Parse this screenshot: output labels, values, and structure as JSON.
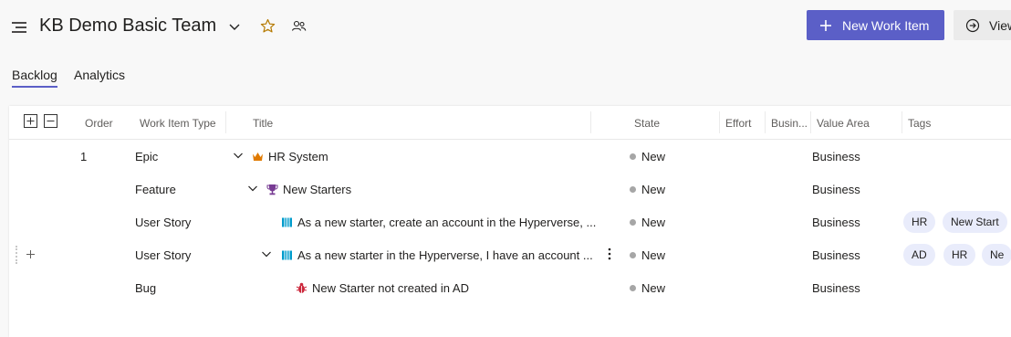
{
  "header": {
    "team_title": "KB Demo Basic Team",
    "new_work_item_label": "New Work Item",
    "view_label": "View",
    "accent_color": "#5b5fc7"
  },
  "tabs": [
    {
      "label": "Backlog",
      "active": true
    },
    {
      "label": "Analytics",
      "active": false
    }
  ],
  "table": {
    "columns": [
      "Order",
      "Work Item Type",
      "Title",
      "State",
      "Effort",
      "Busin...",
      "Value Area",
      "Tags"
    ],
    "rows": [
      {
        "order": "1",
        "type": "Epic",
        "title": "HR System",
        "icon": "crown-icon",
        "state": "New",
        "value_area": "Business",
        "tags": []
      },
      {
        "order": "",
        "type": "Feature",
        "title": "New Starters",
        "icon": "trophy-icon",
        "state": "New",
        "value_area": "Business",
        "tags": []
      },
      {
        "order": "",
        "type": "User Story",
        "title": "As a new starter, create an account in the Hyperverse, ...",
        "icon": "book-icon",
        "state": "New",
        "value_area": "Business",
        "tags": [
          "HR",
          "New Start"
        ]
      },
      {
        "order": "",
        "type": "User Story",
        "title": "As a new starter in the Hyperverse, I have an account ...",
        "icon": "book-icon",
        "state": "New",
        "value_area": "Business",
        "tags": [
          "AD",
          "HR",
          "Ne"
        ]
      },
      {
        "order": "",
        "type": "Bug",
        "title": "New Starter not created in AD",
        "icon": "bug-icon",
        "state": "New",
        "value_area": "Business",
        "tags": []
      }
    ]
  }
}
